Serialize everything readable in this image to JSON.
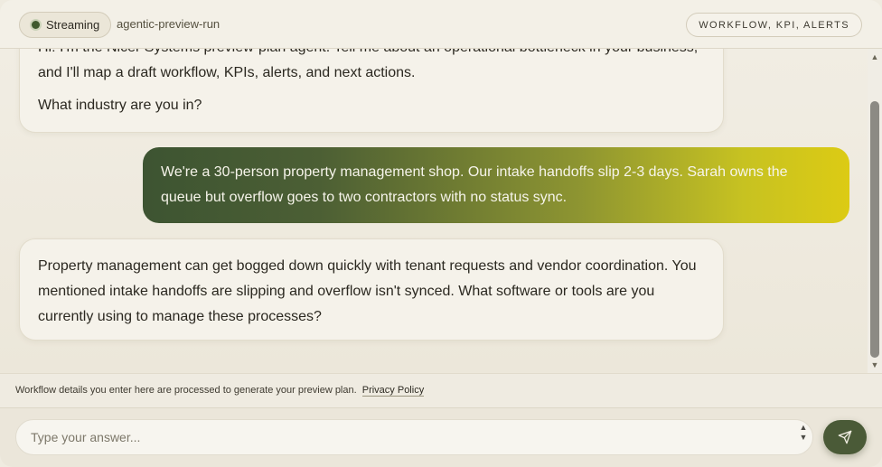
{
  "header": {
    "status_label": "Streaming",
    "run_name": "agentic-preview-run",
    "topics_label": "WORKFLOW, KPI, ALERTS"
  },
  "messages": [
    {
      "role": "assistant",
      "paragraphs": [
        "Hi! I'm the Nicer Systems preview-plan agent. Tell me about an operational bottleneck in your business, and I'll map a draft workflow, KPIs, alerts, and next actions.",
        "What industry are you in?"
      ]
    },
    {
      "role": "user",
      "text": "We're a 30-person property management shop. Our intake handoffs slip 2-3 days. Sarah owns the queue but overflow goes to two contractors with no status sync."
    },
    {
      "role": "assistant",
      "text": "Property management can get bogged down quickly with tenant requests and vendor coordination. You mentioned intake handoffs are slipping and overflow isn't synced. What software or tools are you currently using to manage these processes?"
    }
  ],
  "footer": {
    "note_text": "Workflow details you enter here are processed to generate your preview plan.",
    "privacy_link": "Privacy Policy"
  },
  "composer": {
    "placeholder": "Type your answer...",
    "value": "",
    "send_icon": "paper-plane-icon"
  },
  "colors": {
    "accent_green": "#4a5a37",
    "user_gradient_start": "#3d5432",
    "user_gradient_end": "#dccb14"
  }
}
